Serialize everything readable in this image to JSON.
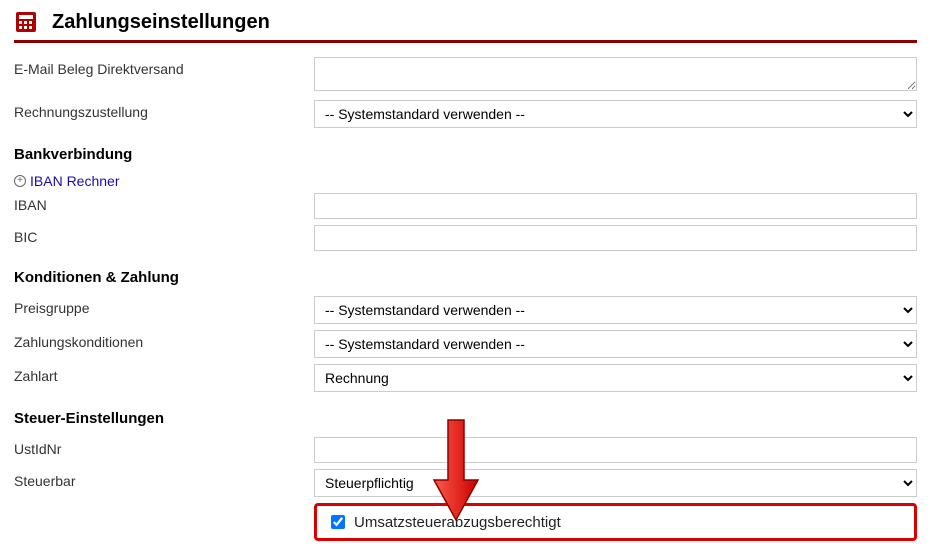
{
  "header": {
    "title": "Zahlungseinstellungen"
  },
  "fields": {
    "email_receipt_label": "E-Mail Beleg Direktversand",
    "invoice_delivery_label": "Rechnungszustellung",
    "invoice_delivery_value": "-- Systemstandard verwenden --",
    "bank_section": "Bankverbindung",
    "iban_calc_link": "IBAN Rechner",
    "iban_label": "IBAN",
    "bic_label": "BIC",
    "conditions_section": "Konditionen & Zahlung",
    "pricegroup_label": "Preisgruppe",
    "pricegroup_value": "-- Systemstandard verwenden --",
    "payment_cond_label": "Zahlungskonditionen",
    "payment_cond_value": "-- Systemstandard verwenden --",
    "payment_type_label": "Zahlart",
    "payment_type_value": "Rechnung",
    "tax_section": "Steuer-Einstellungen",
    "ustid_label": "UstIdNr",
    "taxable_label": "Steuerbar",
    "taxable_value": "Steuerpflichtig",
    "vat_deduct_label": "Umsatzsteuerabzugsberechtigt",
    "vat_deduct_checked": true
  }
}
